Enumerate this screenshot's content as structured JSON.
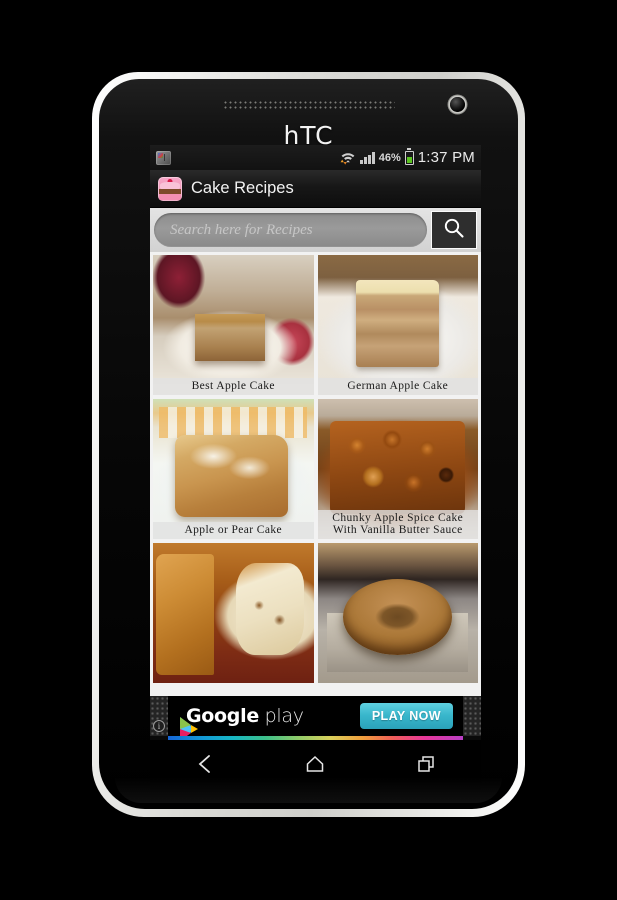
{
  "device": {
    "brand": "hTC",
    "speaker_name": "earpiece-speaker",
    "camera_name": "front-camera"
  },
  "status_bar": {
    "notification_icon": "app-notification-icon",
    "wifi_icon": "wifi-icon",
    "signal_icon": "cell-signal-icon",
    "battery_percent": "46%",
    "battery_level": 46,
    "battery_icon": "battery-icon",
    "time": "1:37 PM"
  },
  "action_bar": {
    "app_icon": "cake-app-icon",
    "title": "Cake Recipes"
  },
  "search": {
    "placeholder": "Search here for Recipes",
    "value": "",
    "button_icon": "search-icon"
  },
  "grid": {
    "cards": [
      {
        "caption": "Best Apple Cake",
        "photo": "p-best",
        "name": "recipe-card-best-apple-cake"
      },
      {
        "caption": "German Apple Cake",
        "photo": "p-german",
        "name": "recipe-card-german-apple-cake"
      },
      {
        "caption": "Apple or Pear Cake",
        "photo": "p-pear",
        "name": "recipe-card-apple-or-pear-cake"
      },
      {
        "caption": "Chunky Apple Spice Cake With Vanilla Butter Sauce",
        "photo": "p-chunky",
        "name": "recipe-card-chunky-apple-spice-cake"
      },
      {
        "caption": "",
        "photo": "p-slice",
        "name": "recipe-card-cinnamon-swirl-cake"
      },
      {
        "caption": "",
        "photo": "p-bundt",
        "name": "recipe-card-bundt-cake"
      }
    ]
  },
  "ad": {
    "brand_bold": "Google",
    "brand_light": " play",
    "cta_label": "PLAY NOW",
    "info_label": "i",
    "accent_color": "#38b6cb"
  },
  "nav_bar": {
    "back_label": "Back",
    "home_label": "Home",
    "recents_label": "Recent apps"
  }
}
